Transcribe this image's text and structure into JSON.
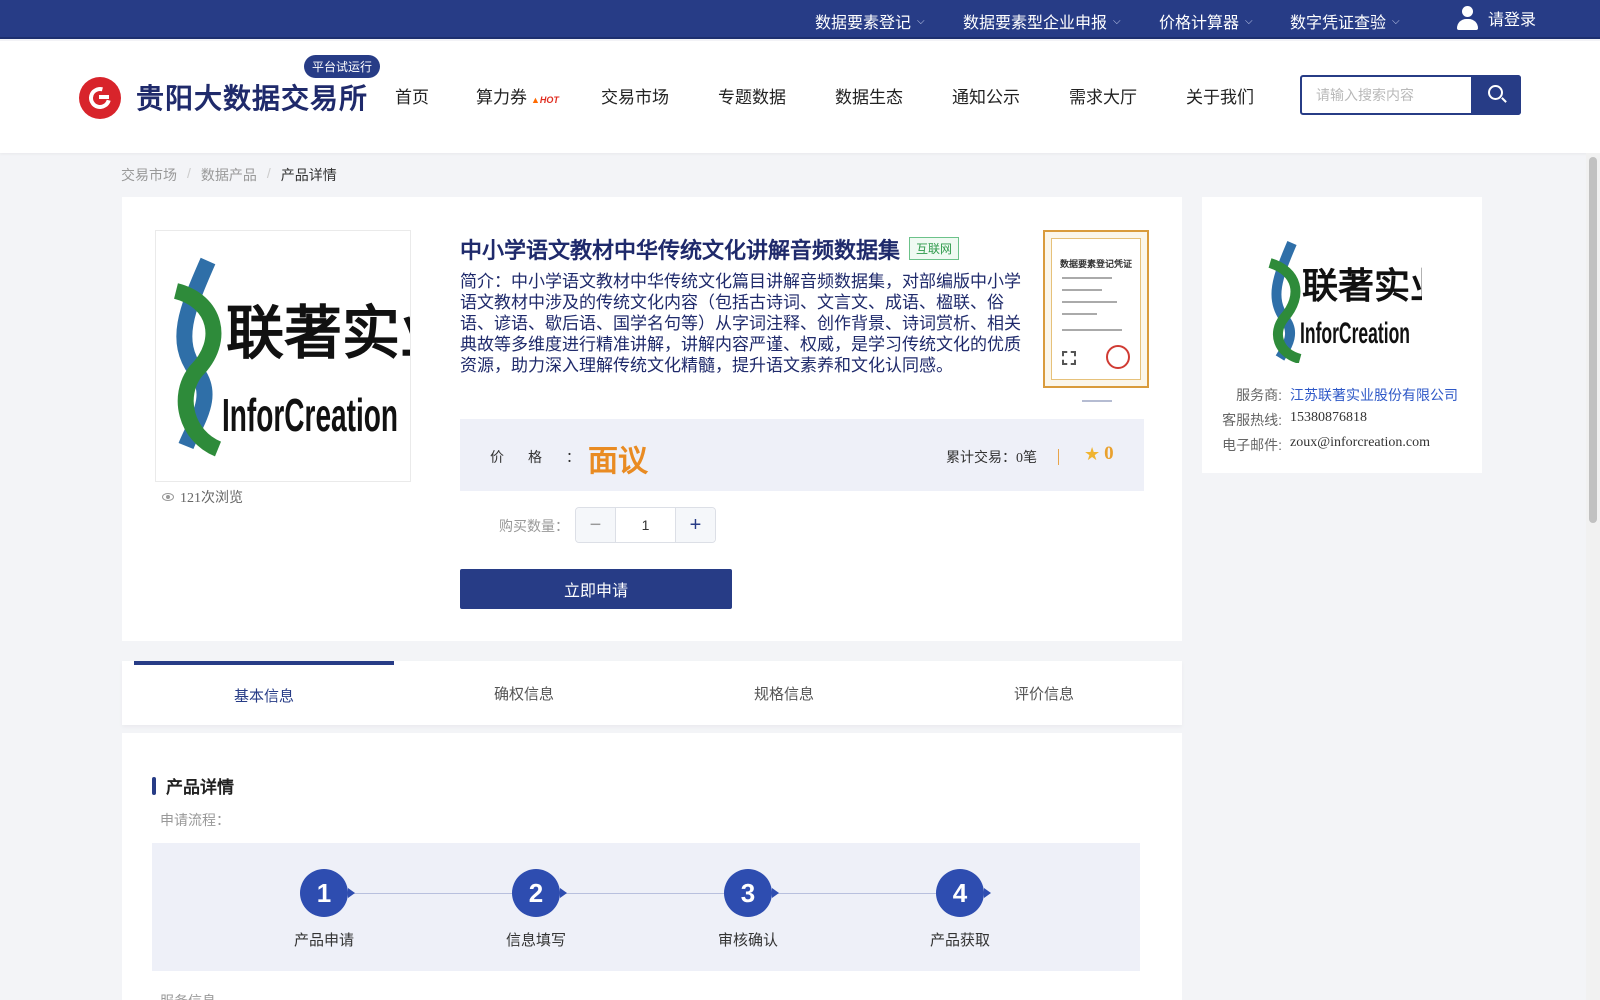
{
  "topbar": {
    "links": [
      "数据要素登记",
      "数据要素型企业申报",
      "价格计算器",
      "数字凭证查验"
    ],
    "login": "请登录"
  },
  "header": {
    "site_title": "贵阳大数据交易所",
    "badge": "平台试运行",
    "nav": [
      "首页",
      "算力券",
      "交易市场",
      "专题数据",
      "数据生态",
      "通知公示",
      "需求大厅",
      "关于我们"
    ],
    "hot_tag": "HOT",
    "search_placeholder": "请输入搜索内容"
  },
  "breadcrumb": [
    "交易市场",
    "数据产品",
    "产品详情"
  ],
  "product": {
    "title": "中小学语文教材中华传统文化讲解音频数据集",
    "tag": "互联网",
    "description": "简介：中小学语文教材中华传统文化篇目讲解音频数据集，对部编版中小学语文教材中涉及的传统文化内容（包括古诗词、文言文、成语、楹联、俗语、谚语、歇后语、国学名句等）从字词注释、创作背景、诗词赏析、相关典故等多维度进行精准讲解，讲解内容严谨、权威，是学习传统文化的优质资源，助力深入理解传统文化精髓，提升语文素养和文化认同感。",
    "certificate_title": "数据要素登记凭证",
    "views": "121次浏览",
    "price_label": "价格：",
    "price": "面议",
    "trades": "累计交易：0笔",
    "rating": "0",
    "quantity_label": "购买数量：",
    "quantity": "1",
    "apply_button": "立即申请",
    "logo_cn": "联著实业",
    "logo_en": "InforCreation"
  },
  "provider": {
    "logo_cn": "联著实业",
    "logo_en": "InforCreation",
    "rows": [
      {
        "key": "服务商:",
        "value": "江苏联著实业股份有限公司"
      },
      {
        "key": "客服热线:",
        "value": "15380876818"
      },
      {
        "key": "电子邮件:",
        "value": "zoux@inforcreation.com"
      }
    ]
  },
  "tabs": [
    "基本信息",
    "确权信息",
    "规格信息",
    "评价信息"
  ],
  "details": {
    "heading": "产品详情",
    "flow_label": "申请流程：",
    "steps": [
      {
        "num": "1",
        "label": "产品申请"
      },
      {
        "num": "2",
        "label": "信息填写"
      },
      {
        "num": "3",
        "label": "审核确认"
      },
      {
        "num": "4",
        "label": "产品获取"
      }
    ],
    "service_label": "服务信息"
  },
  "colors": {
    "brand": "#273c86",
    "price": "#e98b22",
    "logo_red": "#d8242b"
  }
}
